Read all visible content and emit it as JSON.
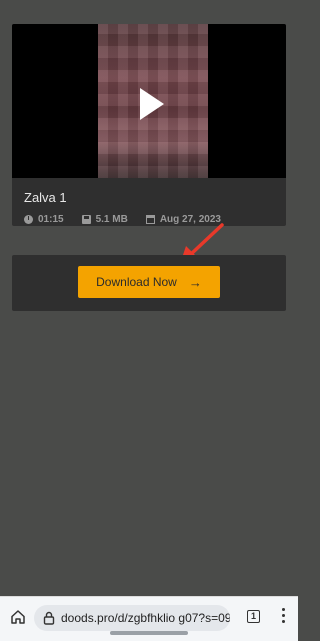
{
  "video": {
    "title": "Zalva 1",
    "duration": "01:15",
    "size": "5.1 MB",
    "date": "Aug 27, 2023"
  },
  "download": {
    "label": "Download Now",
    "arrow": "→"
  },
  "browser": {
    "url": "doods.pro/d/zgbfhklio g07?s=09",
    "tab_count": "1"
  },
  "colors": {
    "accent": "#f4a300",
    "annotation": "#e8392a",
    "page_bg": "#4a4b49"
  }
}
